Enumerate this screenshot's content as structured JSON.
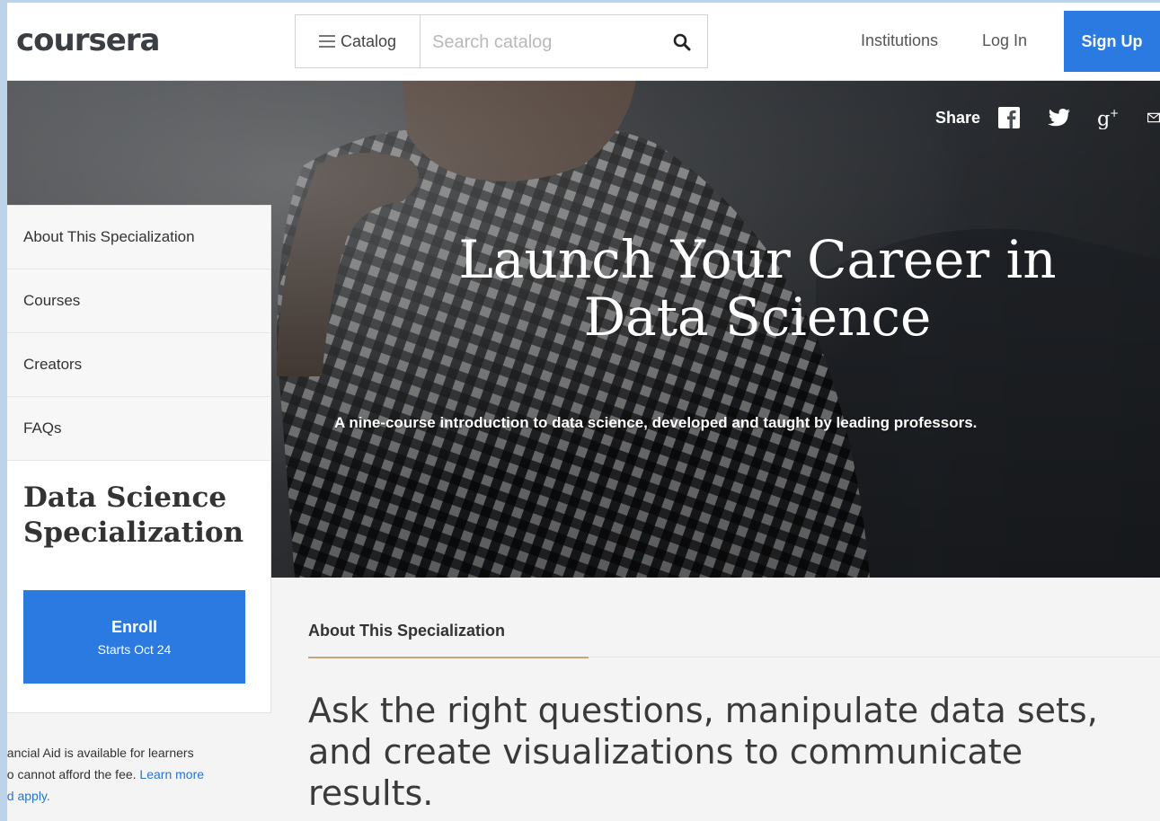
{
  "header": {
    "logo": "coursera",
    "catalog_label": "Catalog",
    "search_placeholder": "Search catalog",
    "nav": {
      "institutions": "Institutions",
      "login": "Log In",
      "signup": "Sign Up"
    }
  },
  "hero": {
    "share_label": "Share",
    "share_icons": [
      "facebook-icon",
      "twitter-icon",
      "google-plus-icon",
      "email-icon"
    ],
    "title_line1": "Launch Your Career in",
    "title_line2": "Data Science",
    "subtitle": "A nine-course introduction to data science, developed and taught by leading professors."
  },
  "sidebar": {
    "items": [
      {
        "label": "About This Specialization"
      },
      {
        "label": "Courses"
      },
      {
        "label": "Creators"
      },
      {
        "label": "FAQs"
      }
    ],
    "card_title_line1": "Data Science",
    "card_title_line2": "Specialization",
    "enroll_label": "Enroll",
    "enroll_sub": "Starts Oct 24",
    "aid_line1": "nancial Aid is available for learners",
    "aid_line2_text": "ho cannot afford the fee. ",
    "aid_link_1": "Learn more",
    "aid_link_2": "nd apply."
  },
  "main": {
    "section_label": "About This Specialization",
    "heading": "Ask the right questions, manipulate data sets, and create visualizations to communicate results."
  },
  "colors": {
    "primary_blue": "#2a7ae2",
    "link_blue": "#2a73cc",
    "underline_accent": "#c9a47a"
  }
}
